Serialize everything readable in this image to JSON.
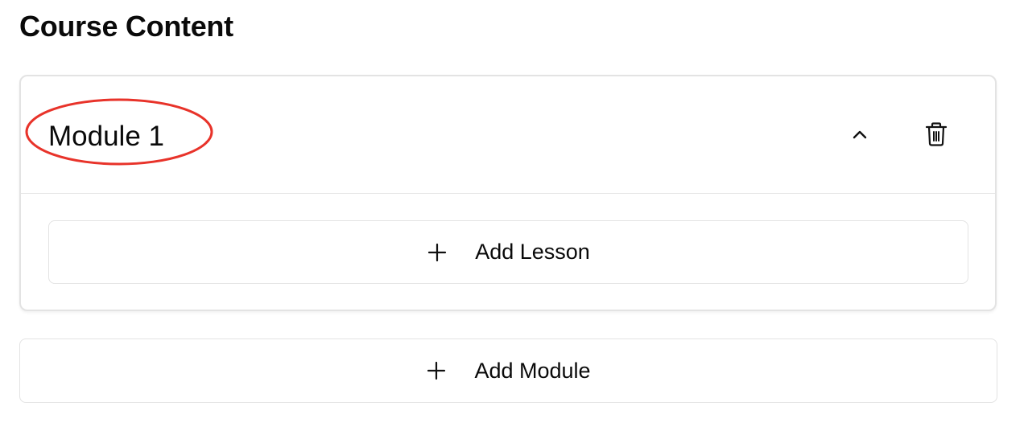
{
  "page": {
    "title": "Course Content"
  },
  "modules": [
    {
      "title": "Module 1",
      "expanded": true,
      "collapse_icon": "chevron-up-icon",
      "delete_icon": "trash-icon",
      "add_lesson_label": "Add Lesson",
      "add_lesson_icon": "plus-icon"
    }
  ],
  "add_module": {
    "label": "Add Module",
    "icon": "plus-icon"
  },
  "annotation": {
    "shape": "ellipse",
    "color": "#e8332a",
    "target": "module-title"
  },
  "colors": {
    "text": "#0a0a0a",
    "border": "#e3e3e3",
    "background": "#ffffff"
  }
}
